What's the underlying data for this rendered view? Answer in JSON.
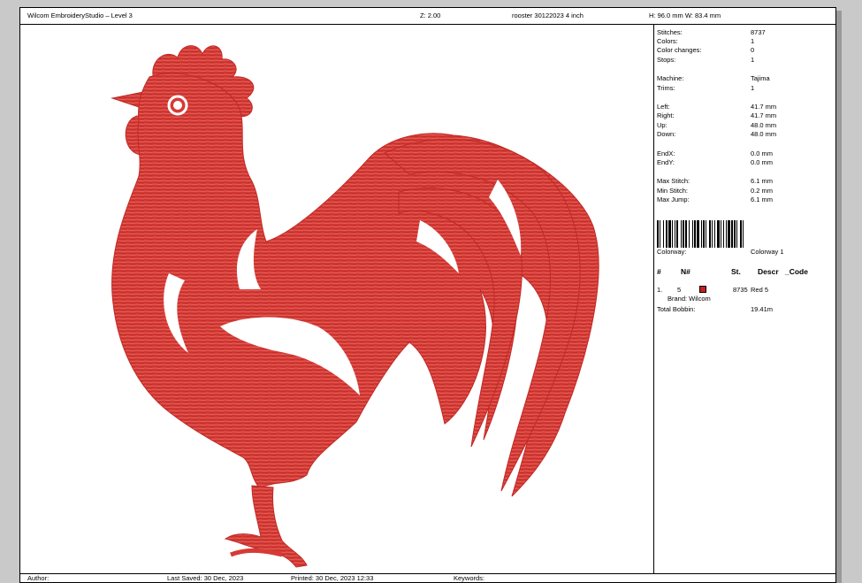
{
  "header": {
    "app_title": "Wilcom EmbroideryStudio – Level 3",
    "zoom": "Z: 2.00",
    "design_name": "rooster 30122023 4 inch",
    "dimensions": "H: 96.0 mm   W: 83.4 mm"
  },
  "stats": [
    {
      "label": "Stitches:",
      "value": "8737"
    },
    {
      "label": "Colors:",
      "value": "1"
    },
    {
      "label": "Color changes:",
      "value": "0"
    },
    {
      "label": "Stops:",
      "value": "1"
    },
    {
      "label": "Machine:",
      "value": "Tajima"
    },
    {
      "label": "Trims:",
      "value": "1"
    },
    {
      "label": "Left:",
      "value": "41.7 mm"
    },
    {
      "label": "Right:",
      "value": "41.7 mm"
    },
    {
      "label": "Up:",
      "value": "48.0 mm"
    },
    {
      "label": "Down:",
      "value": "48.0 mm"
    },
    {
      "label": "EndX:",
      "value": "0.0 mm"
    },
    {
      "label": "EndY:",
      "value": "0.0 mm"
    },
    {
      "label": "Max Stitch:",
      "value": "6.1 mm"
    },
    {
      "label": "Min Stitch:",
      "value": "0.2 mm"
    },
    {
      "label": "Max Jump:",
      "value": "6.1 mm"
    }
  ],
  "colorway": {
    "label": "Colorway:",
    "value": "Colorway 1"
  },
  "table": {
    "headers": [
      "#",
      "N#",
      "St.",
      "Descr",
      "_Code"
    ],
    "rows": [
      {
        "index": "1.",
        "number": "5",
        "color": "#c8201e",
        "stitches": "8735",
        "descr": "Red 5",
        "brand": "Brand: Wilcom"
      }
    ]
  },
  "total_bobbin": {
    "label": "Total Bobbin:",
    "value": "19.41m"
  },
  "footer": {
    "author": "Author:",
    "last_saved": "Last Saved: 30 Dec, 2023",
    "printed": "Printed:  30 Dec, 2023 12:33",
    "keywords": "Keywords:"
  },
  "design": {
    "thread_color": "#d8322f",
    "icon": "rooster-embroidery"
  }
}
